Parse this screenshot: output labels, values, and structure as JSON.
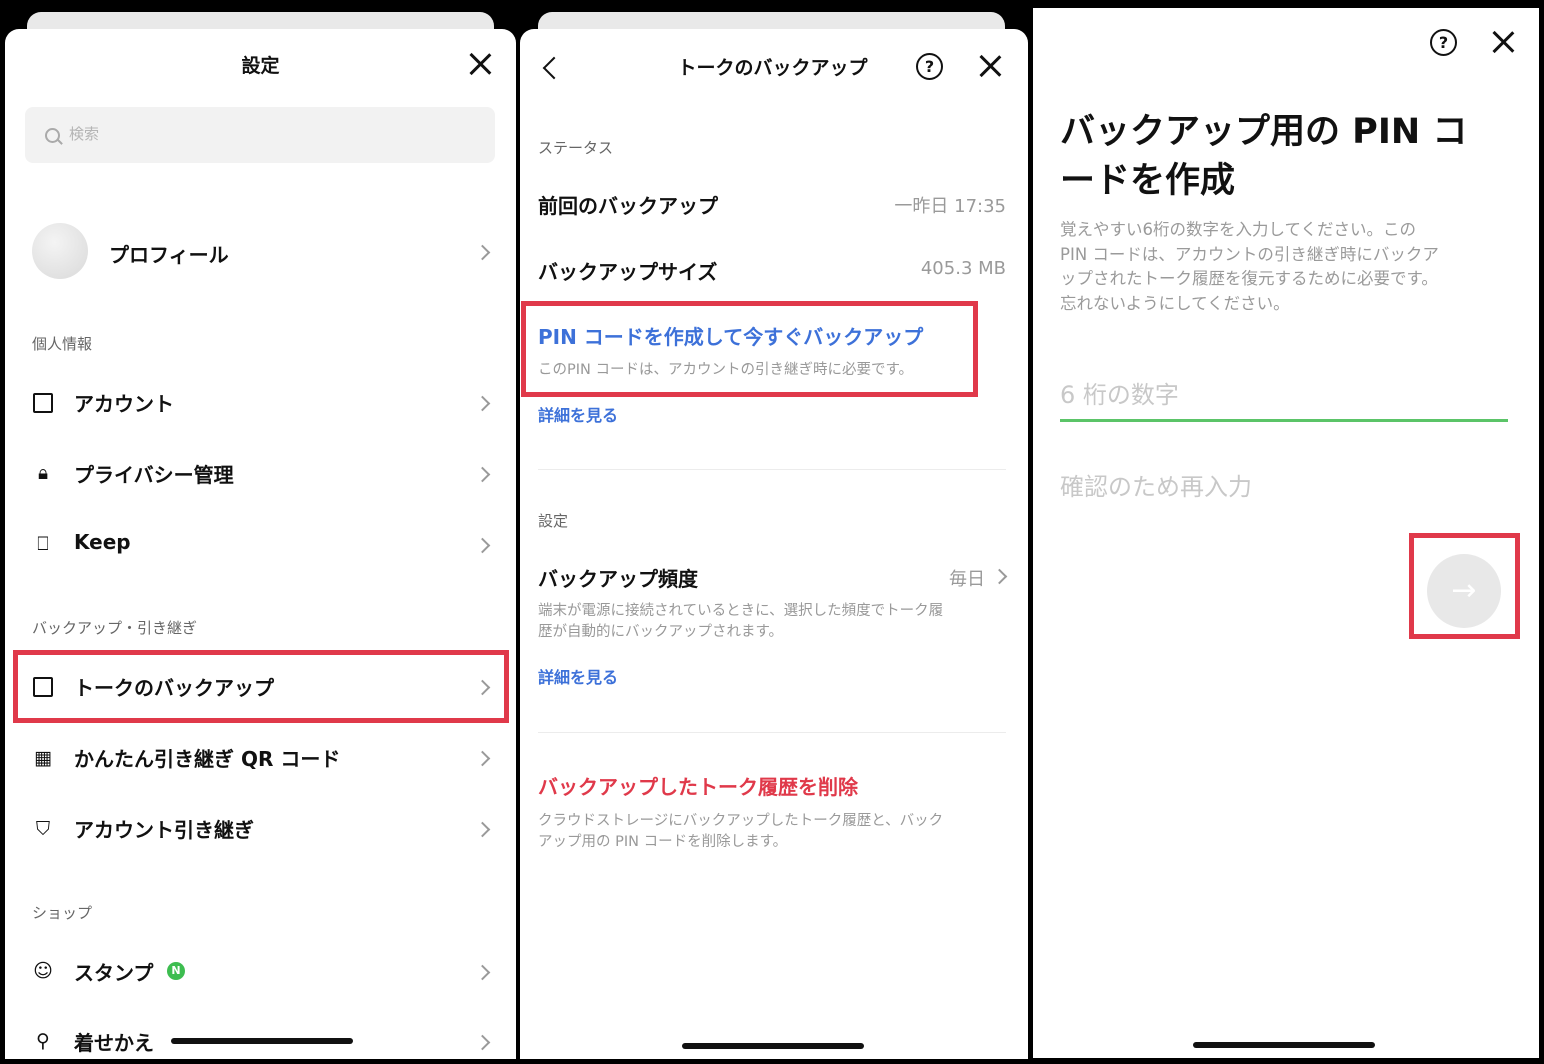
{
  "settings": {
    "title": "設定",
    "search_placeholder": "検索",
    "profile_label": "プロフィール",
    "sections": {
      "personal": "個人情報",
      "backup": "バックアップ・引き継ぎ",
      "shop": "ショップ"
    },
    "items": [
      {
        "label": "アカウント",
        "icon": "id-card-icon"
      },
      {
        "label": "プライバシー管理",
        "icon": "lock-icon"
      },
      {
        "label": "Keep",
        "icon": "bookmark-icon"
      },
      {
        "label": "トークのバックアップ",
        "icon": "backup-folder-icon"
      },
      {
        "label": "かんたん引き継ぎ QR コード",
        "icon": "qr-code-icon"
      },
      {
        "label": "アカウント引き継ぎ",
        "icon": "shield-icon"
      },
      {
        "label": "スタンプ",
        "icon": "smiley-icon",
        "badge": "N"
      },
      {
        "label": "着せかえ",
        "icon": "brush-icon"
      }
    ],
    "badge_color": "#3dbd50"
  },
  "backup": {
    "title": "トークのバックアップ",
    "status_section": "ステータス",
    "last_backup_label": "前回のバックアップ",
    "last_backup_value": "一昨日 17:35",
    "size_label": "バックアップサイズ",
    "size_value": "405.3 MB",
    "pin_link": "PIN コードを作成して今すぐバックアップ",
    "pin_desc": "このPIN コードは、アカウントの引き継ぎ時に必要です。",
    "details_link_1": "詳細を見る",
    "settings_section": "設定",
    "frequency_label": "バックアップ頻度",
    "frequency_value": "毎日",
    "frequency_desc_1": "端末が電源に接続されているときに、選択した頻度でトーク履",
    "frequency_desc_2": "歴が自動的にバックアップされます。",
    "details_link_2": "詳細を見る",
    "delete_label": "バックアップしたトーク履歴を削除",
    "delete_desc_1": "クラウドストレージにバックアップしたトーク履歴と、バック",
    "delete_desc_2": "アップ用の PIN コードを削除します。",
    "link_color": "#3d71d9",
    "danger_color": "#e0394a"
  },
  "pin": {
    "title_1": "バックアップ用の PIN コ",
    "title_2": "ードを作成",
    "desc_1": "覚えやすい6桁の数字を入力してください。この",
    "desc_2": "PIN コードは、アカウントの引き継ぎ時にバックア",
    "desc_3": "ップされたトーク履歴を復元するために必要です。",
    "desc_4": "忘れないようにしてください。",
    "pin_placeholder": "6 桁の数字",
    "confirm_placeholder": "確認のため再入力",
    "next_icon": "arrow-right-icon",
    "accent_color": "#5bc468",
    "highlight_color": "#e0394a"
  }
}
